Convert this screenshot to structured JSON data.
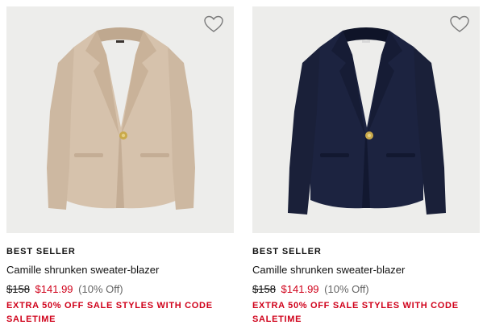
{
  "products": [
    {
      "badge": "BEST SELLER",
      "name": "Camille shrunken sweater-blazer",
      "original_price": "$158",
      "sale_price": "$141.99",
      "discount": "(10% Off)",
      "promo": "EXTRA 50% OFF SALE STYLES WITH CODE SALETIME",
      "image_colors": {
        "background": "#ededeb",
        "fabric": "#d6c2ac",
        "fabric_shadow": "#c4ad95",
        "button": "#c9a94a"
      },
      "favorite_icon": "heart-outline-icon"
    },
    {
      "badge": "BEST SELLER",
      "name": "Camille shrunken sweater-blazer",
      "original_price": "$158",
      "sale_price": "$141.99",
      "discount": "(10% Off)",
      "promo": "EXTRA 50% OFF SALE STYLES WITH CODE SALETIME",
      "image_colors": {
        "background": "#ededeb",
        "fabric": "#1c2340",
        "fabric_shadow": "#121830",
        "button": "#c9a94a"
      },
      "favorite_icon": "heart-outline-icon"
    }
  ],
  "colors": {
    "sale_red": "#d0021b",
    "text": "#111111",
    "muted": "#666666"
  }
}
